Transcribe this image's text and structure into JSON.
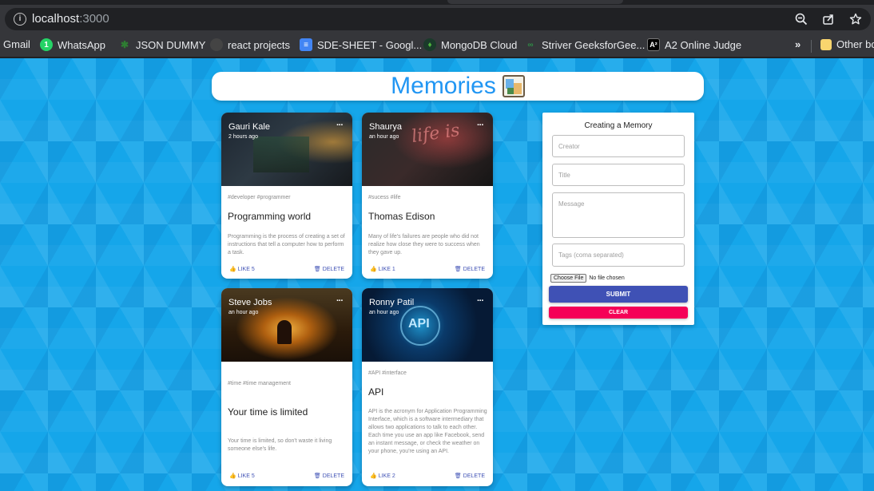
{
  "browser": {
    "url_host": "localhost",
    "url_port": ":3000",
    "bookmarks": [
      {
        "label": "Gmail",
        "icon": "gmail-icon"
      },
      {
        "label": "WhatsApp",
        "icon": "whatsapp-icon"
      },
      {
        "label": "JSON DUMMY",
        "icon": "json-dummy-icon"
      },
      {
        "label": "react projects",
        "icon": "github-icon"
      },
      {
        "label": "SDE-SHEET - Googl...",
        "icon": "google-docs-icon"
      },
      {
        "label": "MongoDB Cloud",
        "icon": "mongodb-icon"
      },
      {
        "label": "Striver GeeksforGee...",
        "icon": "geeksforgeeks-icon"
      },
      {
        "label": "A2 Online Judge",
        "icon": "a2-icon"
      },
      {
        "label": "Other bo",
        "icon": "folder-icon"
      }
    ],
    "overflow_label": "»"
  },
  "app": {
    "title": "Memories",
    "accent": "#2196f3"
  },
  "cards": [
    {
      "creator": "Gauri Kale",
      "time": "2 hours ago",
      "tags": "#developer #programmer",
      "title": "Programming world",
      "message": "Programming is the process of creating a set of instructions that tell a computer how to perform a task.",
      "like_label": "LIKE 5",
      "delete_label": "DELETE",
      "more": "···"
    },
    {
      "creator": "Shaurya",
      "time": "an hour ago",
      "tags": "#sucess #life",
      "title": "Thomas Edison",
      "message": "Many of life's failures are people who did not realize how close they were to success when they gave up.",
      "like_label": "LIKE 1",
      "delete_label": "DELETE",
      "more": "···"
    },
    {
      "creator": "Steve Jobs",
      "time": "an hour ago",
      "tags": "#time #time management",
      "title": "Your time is limited",
      "message": "Your time is limited, so don't waste it living someone else's life.",
      "like_label": "LIKE 5",
      "delete_label": "DELETE",
      "more": "···"
    },
    {
      "creator": "Ronny Patil",
      "time": "an hour ago",
      "tags": "#API #interface",
      "title": "API",
      "message": "API is the acronym for Application Programming Interface, which is a software intermediary that allows two applications to talk to each other. Each time you use an app like Facebook, send an instant message, or check the weather on your phone, you're using an API.",
      "like_label": "LIKE 2",
      "delete_label": "DELETE",
      "more": "···"
    }
  ],
  "form": {
    "title": "Creating a Memory",
    "creator_placeholder": "Creator",
    "title_placeholder": "Title",
    "message_placeholder": "Message",
    "tags_placeholder": "Tags (coma separated)",
    "file_button": "Choose File",
    "file_status": "No file chosen",
    "submit_label": "SUBMIT",
    "clear_label": "CLEAR",
    "submit_color": "#3f51b5",
    "clear_color": "#f50057"
  }
}
